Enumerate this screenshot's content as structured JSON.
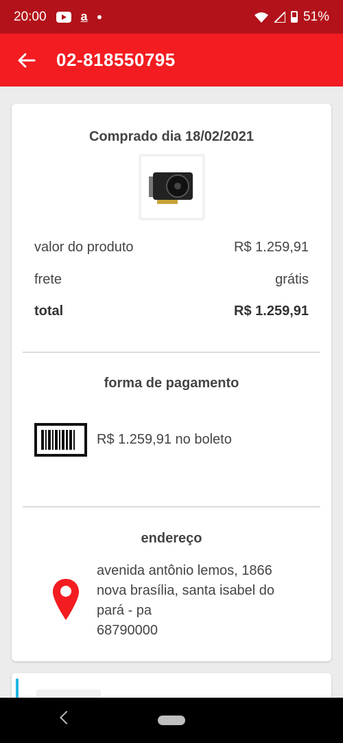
{
  "status_bar": {
    "time": "20:00",
    "amazon_glyph": "a",
    "battery": "51%",
    "icons": [
      "youtube-icon",
      "amazon-icon",
      "notification-dot-icon",
      "wifi-icon",
      "signal-icon",
      "battery-icon"
    ]
  },
  "app_bar": {
    "title": "02-818550795",
    "back_icon": "arrow-left-icon",
    "colors": {
      "status": "#b3121a",
      "bar": "#f21c21"
    }
  },
  "order": {
    "purchase_date": "Comprado dia 18/02/2021",
    "product_image": "graphics-card",
    "rows": [
      {
        "label": "valor do produto",
        "value": "R$ 1.259,91"
      },
      {
        "label": "frete",
        "value": "grátis"
      },
      {
        "label": "total",
        "value": "R$ 1.259,91"
      }
    ]
  },
  "payment": {
    "title": "forma de pagamento",
    "icon": "barcode-icon",
    "text": "R$ 1.259,91 no boleto"
  },
  "address": {
    "title": "endereço",
    "icon": "location-pin-icon",
    "line1": "avenida antônio lemos, 1866",
    "line2": "nova brasília, santa isabel do",
    "line3": "pará - pa",
    "line4": "68790000"
  },
  "nav": {
    "icons": [
      "back-icon",
      "home-pill-icon"
    ]
  }
}
